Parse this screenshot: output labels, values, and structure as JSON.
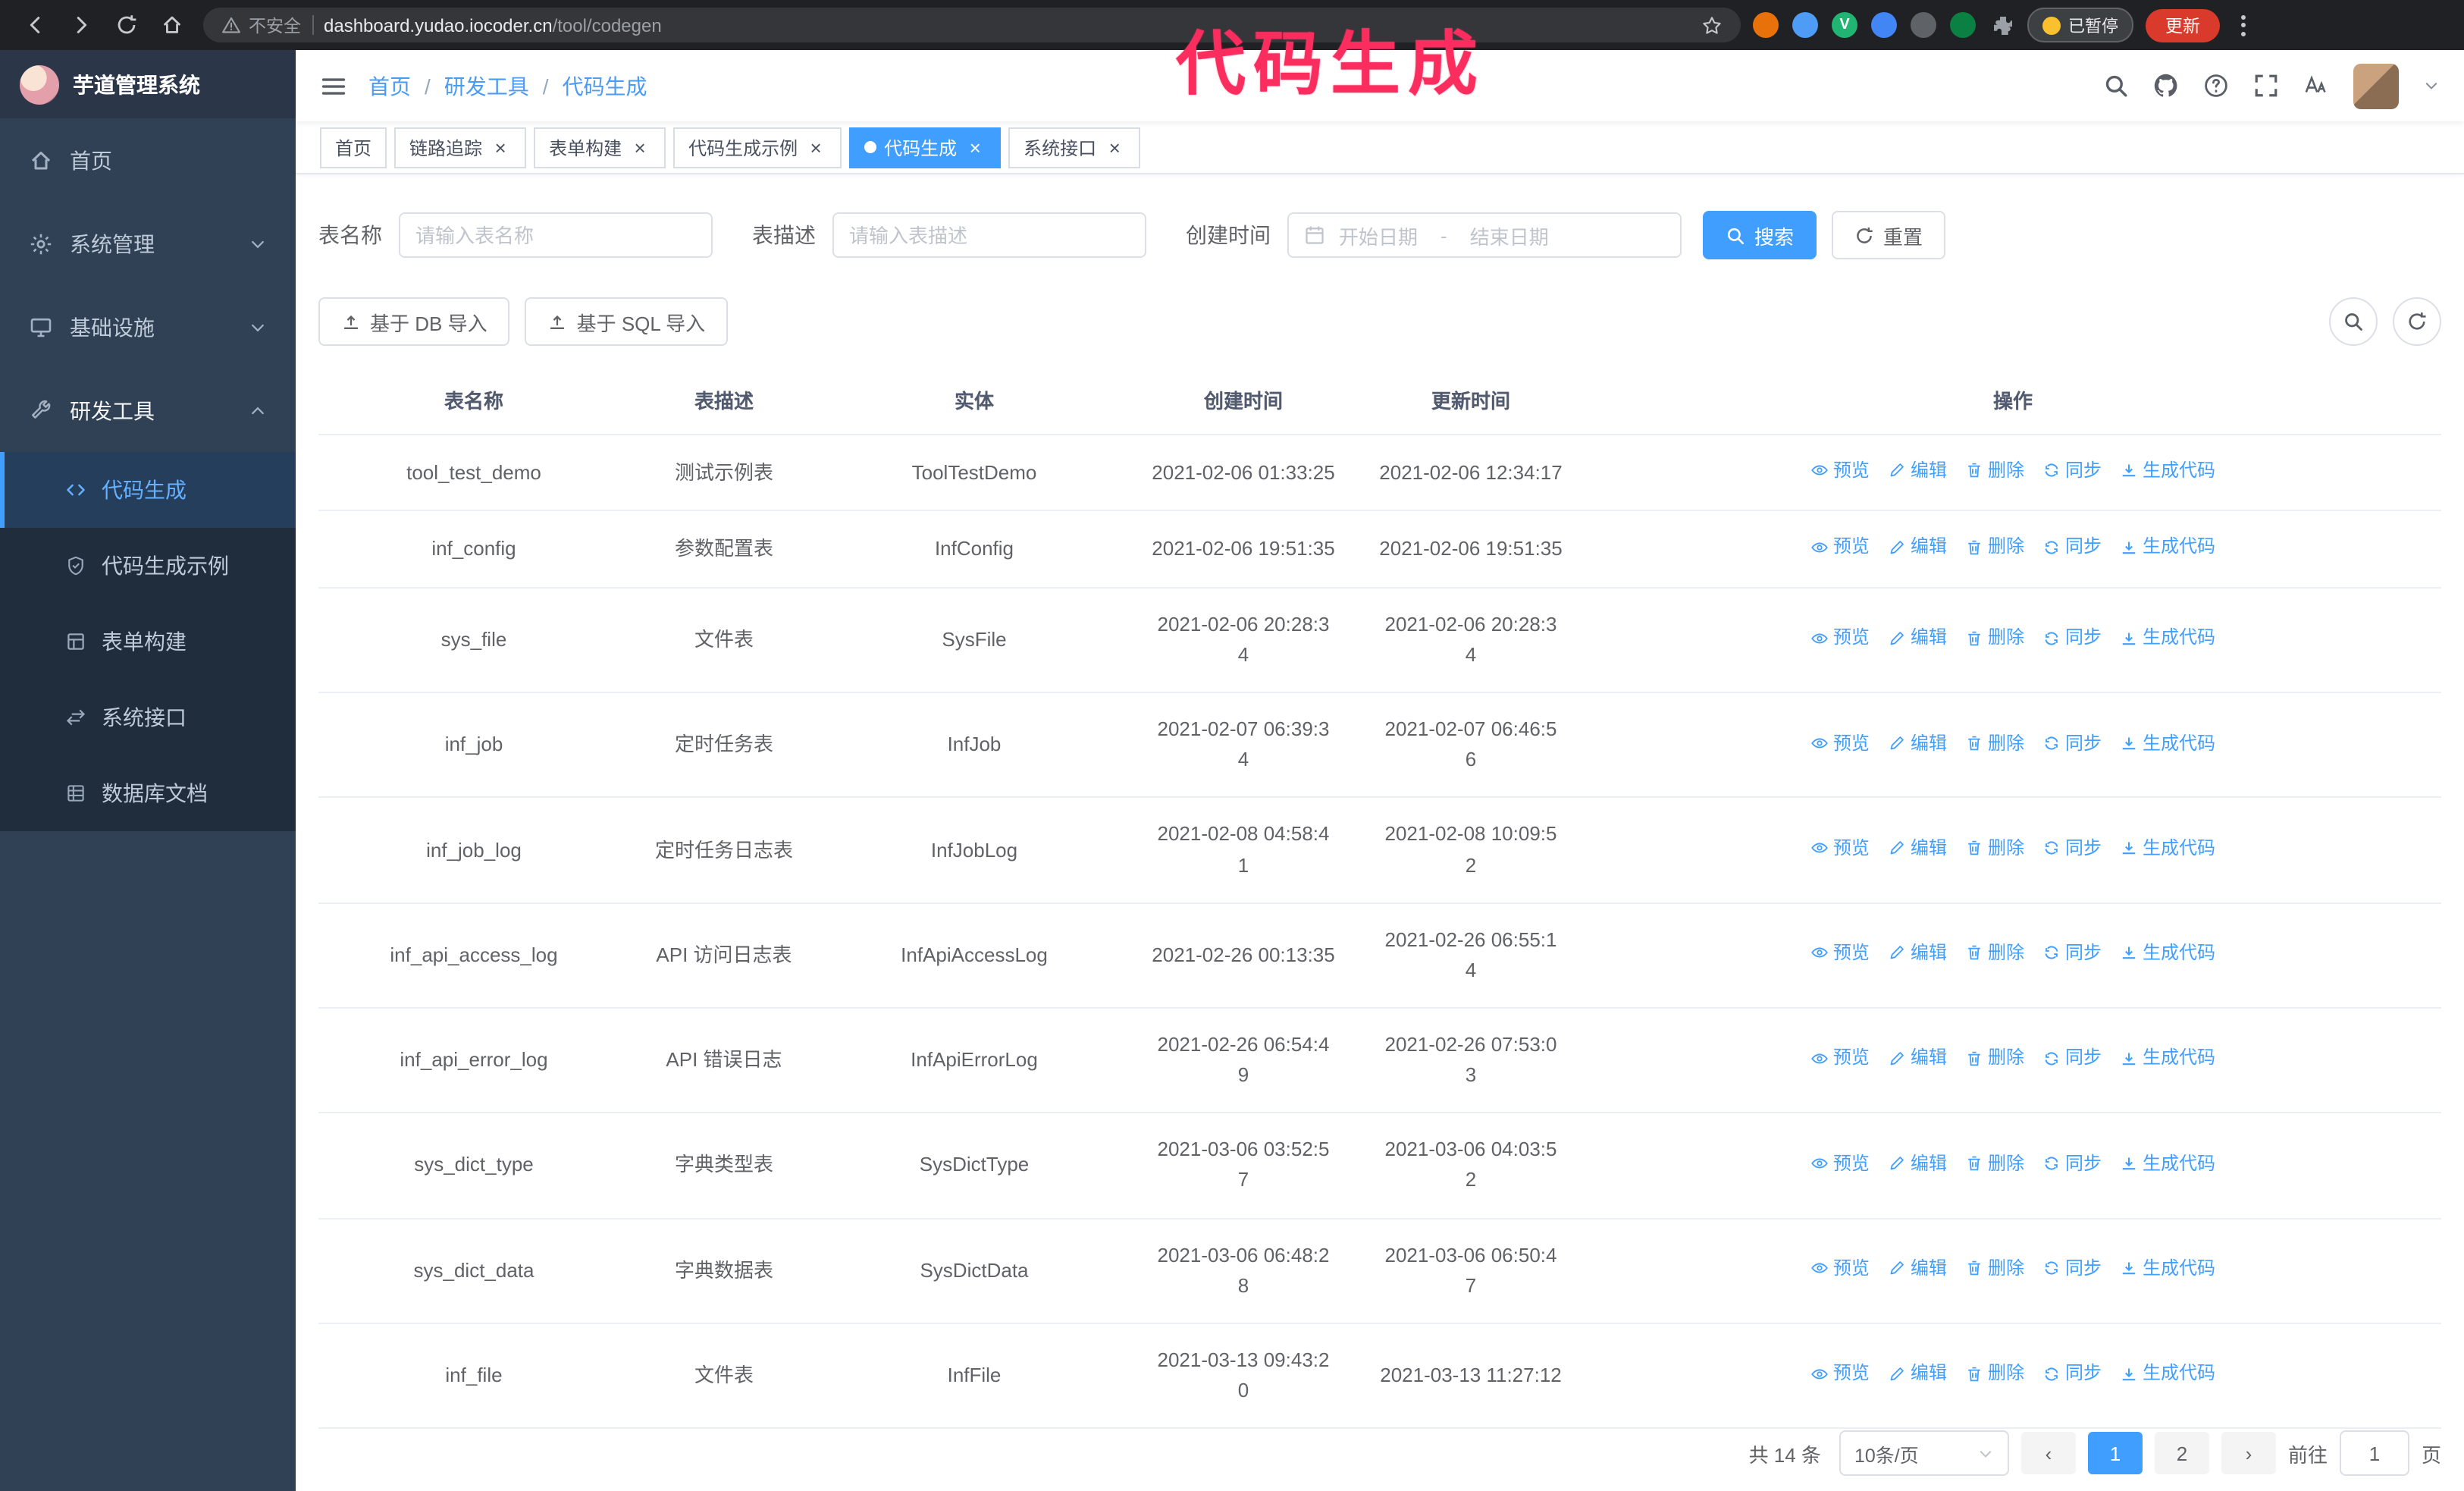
{
  "colors": {
    "accent": "#409eff",
    "sidebar_bg": "#304156",
    "submenu_bg": "#1f2d3d",
    "annotation": "#fb2d5f",
    "update_button_bg": "#d93a2b"
  },
  "annotation": {
    "text": "代码生成"
  },
  "browser": {
    "nav_icons": [
      "back",
      "fwd",
      "reload",
      "home"
    ],
    "security_label": "不安全",
    "url_host": "dashboard.yudao.iocoder.cn",
    "url_path": "/tool/codegen",
    "extensions": [
      {
        "name": "orange-extension-icon",
        "color": "#e8710a",
        "glyph": ""
      },
      {
        "name": "blue-extension-icon",
        "color": "#4f9cf7",
        "glyph": ""
      },
      {
        "name": "vue-devtools-icon",
        "color": "#21b573",
        "glyph": "V"
      },
      {
        "name": "profiles-extension-icon",
        "color": "#4285f4",
        "glyph": ""
      },
      {
        "name": "gray-extension-icon",
        "color": "#5f6368",
        "glyph": ""
      },
      {
        "name": "green-extension-icon",
        "color": "#0b8043",
        "glyph": ""
      },
      {
        "name": "puzzle-extension-icon",
        "color": "#80868b",
        "glyph": ""
      }
    ],
    "paused_badge": "已暂停",
    "update_button": "更新"
  },
  "sidebar": {
    "app_title": "芋道管理系统",
    "items": [
      {
        "key": "home",
        "label": "首页",
        "icon": "home",
        "expandable": false,
        "expanded": false
      },
      {
        "key": "system",
        "label": "系统管理",
        "icon": "gear",
        "expandable": true,
        "expanded": false
      },
      {
        "key": "infra",
        "label": "基础设施",
        "icon": "infra",
        "expandable": true,
        "expanded": false
      },
      {
        "key": "devtools",
        "label": "研发工具",
        "icon": "tools",
        "expandable": true,
        "expanded": true
      }
    ],
    "sub_items": [
      {
        "key": "codegen",
        "label": "代码生成",
        "icon": "code",
        "active": true
      },
      {
        "key": "codegen-example",
        "label": "代码生成示例",
        "icon": "badge",
        "active": false
      },
      {
        "key": "form-builder",
        "label": "表单构建",
        "icon": "form",
        "active": false
      },
      {
        "key": "api",
        "label": "系统接口",
        "icon": "api",
        "active": false
      },
      {
        "key": "db-doc",
        "label": "数据库文档",
        "icon": "db",
        "active": false
      }
    ]
  },
  "header": {
    "breadcrumb": [
      "首页",
      "研发工具",
      "代码生成"
    ],
    "separator": "/",
    "icons": [
      "search",
      "github",
      "help",
      "expand",
      "font"
    ]
  },
  "tabs": [
    {
      "key": "home",
      "label": "首页",
      "closable": false,
      "active": false
    },
    {
      "key": "tracer",
      "label": "链路追踪",
      "closable": true,
      "active": false
    },
    {
      "key": "form-builder",
      "label": "表单构建",
      "closable": true,
      "active": false
    },
    {
      "key": "codegen-example",
      "label": "代码生成示例",
      "closable": true,
      "active": false
    },
    {
      "key": "codegen",
      "label": "代码生成",
      "closable": true,
      "active": true
    },
    {
      "key": "api",
      "label": "系统接口",
      "closable": true,
      "active": false
    }
  ],
  "filters": {
    "table_name_label": "表名称",
    "table_name_placeholder": "请输入表名称",
    "table_desc_label": "表描述",
    "table_desc_placeholder": "请输入表描述",
    "create_time_label": "创建时间",
    "date_start_placeholder": "开始日期",
    "range_separator": "-",
    "date_end_placeholder": "结束日期",
    "search_button": "搜索",
    "reset_button": "重置"
  },
  "toolbar": {
    "import_db_label": "基于 DB 导入",
    "import_sql_label": "基于 SQL 导入"
  },
  "table": {
    "columns": [
      "表名称",
      "表描述",
      "实体",
      "创建时间",
      "更新时间",
      "操作"
    ],
    "actions": [
      "预览",
      "编辑",
      "删除",
      "同步",
      "生成代码"
    ],
    "action_icons": [
      "eye",
      "edit",
      "del",
      "sync",
      "down"
    ],
    "rows": [
      {
        "name": "tool_test_demo",
        "desc": "测试示例表",
        "entity": "ToolTestDemo",
        "created": "2021-02-06 01:33:25",
        "updated": "2021-02-06 12:34:17"
      },
      {
        "name": "inf_config",
        "desc": "参数配置表",
        "entity": "InfConfig",
        "created": "2021-02-06 19:51:35",
        "updated": "2021-02-06 19:51:35"
      },
      {
        "name": "sys_file",
        "desc": "文件表",
        "entity": "SysFile",
        "created": "2021-02-06 20:28:3\n4",
        "updated": "2021-02-06 20:28:3\n4"
      },
      {
        "name": "inf_job",
        "desc": "定时任务表",
        "entity": "InfJob",
        "created": "2021-02-07 06:39:3\n4",
        "updated": "2021-02-07 06:46:5\n6"
      },
      {
        "name": "inf_job_log",
        "desc": "定时任务日志表",
        "entity": "InfJobLog",
        "created": "2021-02-08 04:58:4\n1",
        "updated": "2021-02-08 10:09:5\n2"
      },
      {
        "name": "inf_api_access_log",
        "desc": "API 访问日志表",
        "entity": "InfApiAccessLog",
        "created": "2021-02-26 00:13:35",
        "updated": "2021-02-26 06:55:1\n4"
      },
      {
        "name": "inf_api_error_log",
        "desc": "API 错误日志",
        "entity": "InfApiErrorLog",
        "created": "2021-02-26 06:54:4\n9",
        "updated": "2021-02-26 07:53:0\n3"
      },
      {
        "name": "sys_dict_type",
        "desc": "字典类型表",
        "entity": "SysDictType",
        "created": "2021-03-06 03:52:5\n7",
        "updated": "2021-03-06 04:03:5\n2"
      },
      {
        "name": "sys_dict_data",
        "desc": "字典数据表",
        "entity": "SysDictData",
        "created": "2021-03-06 06:48:2\n8",
        "updated": "2021-03-06 06:50:4\n7"
      },
      {
        "name": "inf_file",
        "desc": "文件表",
        "entity": "InfFile",
        "created": "2021-03-13 09:43:2\n0",
        "updated": "2021-03-13 11:27:12"
      }
    ]
  },
  "pagination": {
    "total": "共 14 条",
    "page_size": "10条/页",
    "prev": "‹",
    "next": "›",
    "pages": [
      {
        "label": "1",
        "active": true
      },
      {
        "label": "2",
        "active": false
      }
    ],
    "goto_label": "前往",
    "goto_value": "1",
    "page_unit": "页"
  }
}
